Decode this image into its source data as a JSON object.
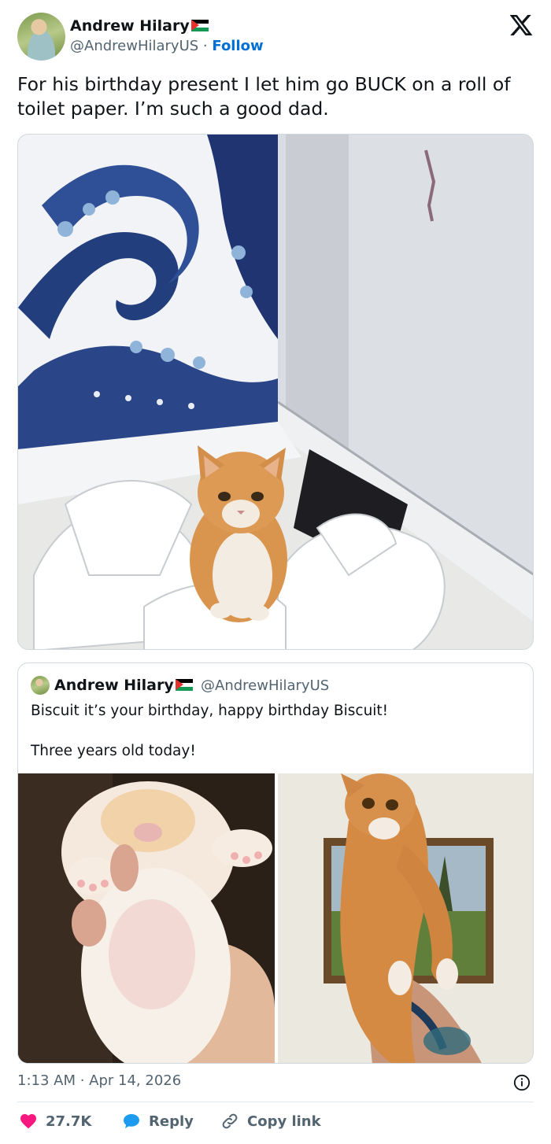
{
  "author": {
    "name": "Andrew Hilary",
    "handle": "@AndrewHilaryUS",
    "separator": "·",
    "follow_label": "Follow"
  },
  "tweet": {
    "text": "For his birthday present I let him go BUCK on a roll of toilet paper. I’m such a good dad."
  },
  "quoted_tweet": {
    "name": "Andrew Hilary",
    "handle": "@AndrewHilaryUS",
    "line1": "Biscuit it’s your birthday, happy birthday Biscuit!",
    "line2": "Three years old today!"
  },
  "meta": {
    "timestamp": "1:13 AM · Apr 14, 2026"
  },
  "actions": {
    "likes": "27.7K",
    "reply_label": "Reply",
    "copy_link_label": "Copy link"
  },
  "colors": {
    "follow_blue": "#006fd6",
    "like_red": "#f91880",
    "reply_blue": "#1d9bf0",
    "muted_text": "#536471"
  },
  "icons": [
    "x-logo-icon",
    "flag-icon",
    "info-icon",
    "heart-icon",
    "speech-bubble-icon",
    "link-icon"
  ]
}
